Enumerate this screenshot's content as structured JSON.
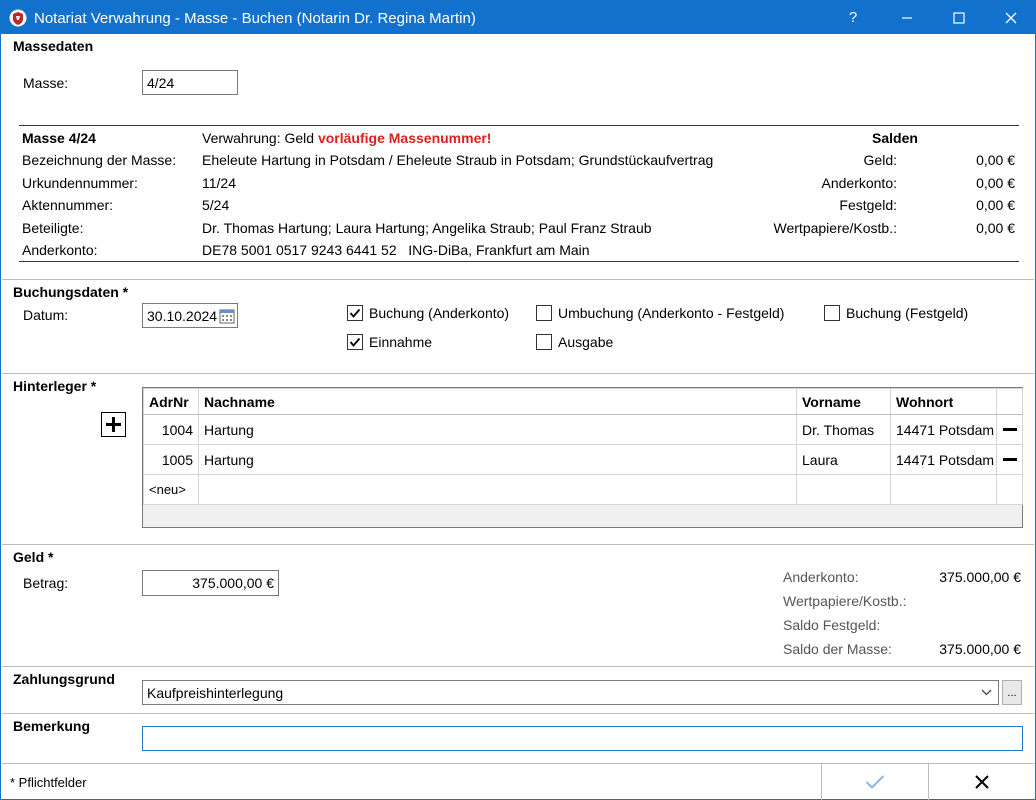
{
  "window": {
    "title": "Notariat Verwahrung - Masse - Buchen (Notarin Dr. Regina Martin)",
    "help_label": "?"
  },
  "massedaten": {
    "section_title": "Massedaten",
    "masse_label": "Masse:",
    "masse_value": "4/24",
    "heading_masse": "Masse 4/24",
    "verwahrung_label": "Verwahrung: Geld",
    "warning": "vorläufige Massenummer!",
    "rows": [
      {
        "label": "Bezeichnung der Masse:",
        "value": "Eheleute Hartung in Potsdam / Eheleute Straub in Potsdam; Grundstückaufvertrag"
      },
      {
        "label": "Urkundennummer:",
        "value": "11/24"
      },
      {
        "label": "Aktennummer:",
        "value": "5/24"
      },
      {
        "label": "Beteiligte:",
        "value": "Dr. Thomas Hartung; Laura Hartung; Angelika Straub; Paul Franz Straub"
      },
      {
        "label": "Anderkonto:",
        "value": "DE78 5001 0517 9243 6441 52   ING-DiBa, Frankfurt am Main"
      }
    ],
    "salden_title": "Salden",
    "salden": [
      {
        "label": "Geld:",
        "value": "0,00 €"
      },
      {
        "label": "Anderkonto:",
        "value": "0,00 €"
      },
      {
        "label": "Festgeld:",
        "value": "0,00 €"
      },
      {
        "label": "Wertpapiere/Kostb.:",
        "value": "0,00 €"
      }
    ]
  },
  "buchungsdaten": {
    "section_title": "Buchungsdaten *",
    "datum_label": "Datum:",
    "datum_value": "30.10.2024",
    "checkboxes": [
      {
        "label": "Buchung (Anderkonto)",
        "checked": true
      },
      {
        "label": "Umbuchung (Anderkonto - Festgeld)",
        "checked": false
      },
      {
        "label": "Buchung (Festgeld)",
        "checked": false
      },
      {
        "label": "Einnahme",
        "checked": true
      },
      {
        "label": "Ausgabe",
        "checked": false
      }
    ]
  },
  "hinterleger": {
    "section_title": "Hinterleger *",
    "add_label": "+",
    "columns": [
      "AdrNr",
      "Nachname",
      "Vorname",
      "Wohnort"
    ],
    "rows": [
      {
        "adrnr": "1004",
        "nachname": "Hartung",
        "vorname": "Dr. Thomas",
        "wohnort": "14471 Potsdam"
      },
      {
        "adrnr": "1005",
        "nachname": "Hartung",
        "vorname": "Laura",
        "wohnort": "14471 Potsdam"
      }
    ],
    "new_row_label": "<neu>"
  },
  "geld": {
    "section_title": "Geld *",
    "betrag_label": "Betrag:",
    "betrag_value": "375.000,00 €",
    "summary": [
      {
        "label": "Anderkonto:",
        "value": "375.000,00 €"
      },
      {
        "label": "Wertpapiere/Kostb.:",
        "value": ""
      },
      {
        "label": "Saldo Festgeld:",
        "value": ""
      },
      {
        "label": "Saldo der Masse:",
        "value": "375.000,00 €"
      }
    ]
  },
  "zahlungsgrund": {
    "section_title": "Zahlungsgrund",
    "value": "Kaufpreishinterlegung",
    "more_label": "..."
  },
  "bemerkung": {
    "section_title": "Bemerkung",
    "value": ""
  },
  "footer": {
    "note": "* Pflichtfelder"
  },
  "colors": {
    "title_bar": "#1171cc",
    "warning": "#e02020",
    "focus_border": "#2a7ad0"
  }
}
